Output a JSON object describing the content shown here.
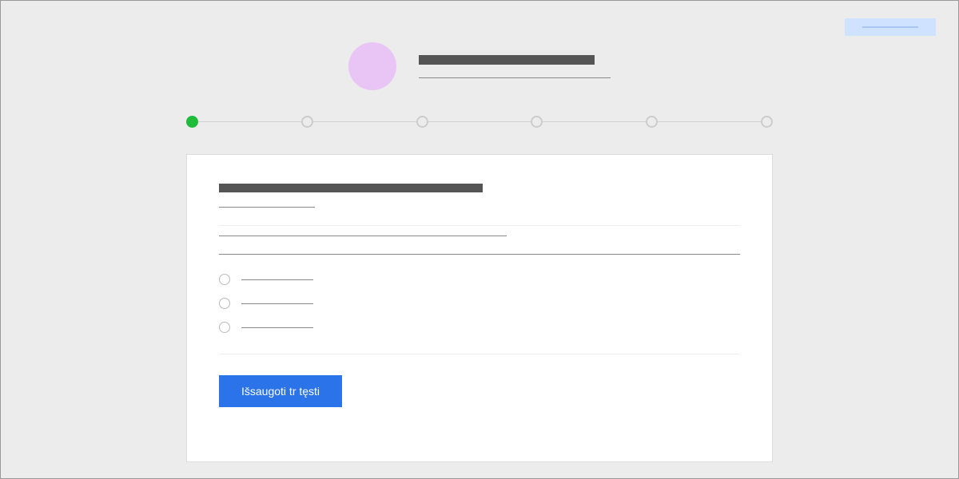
{
  "header": {
    "badge_text": "",
    "title": "",
    "subtitle": ""
  },
  "progress": {
    "current_step": 1,
    "total_steps": 6
  },
  "form": {
    "section_title": "",
    "section_subtitle": "",
    "field_label_1": "",
    "field_value_1": "",
    "options": [
      {
        "label": ""
      },
      {
        "label": ""
      },
      {
        "label": ""
      }
    ],
    "submit_label": "Išsaugoti tr tęsti"
  }
}
